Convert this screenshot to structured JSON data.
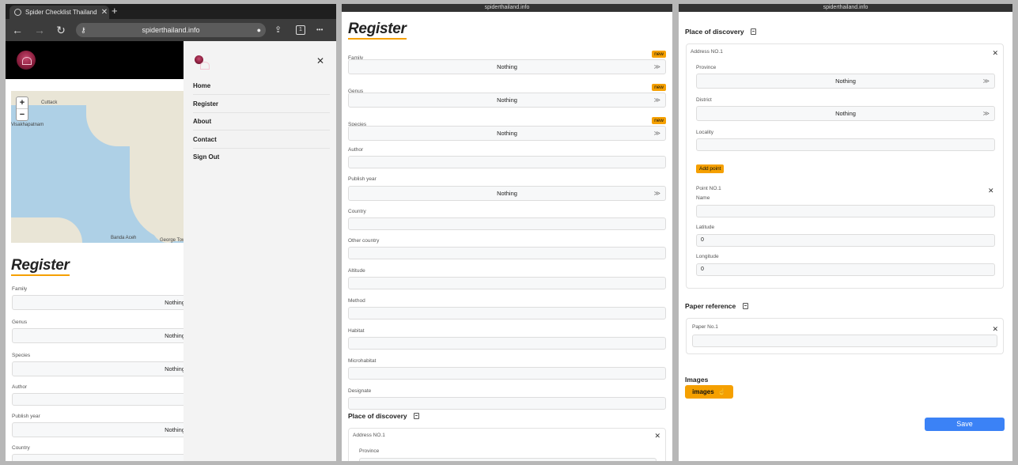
{
  "panel1": {
    "browser": {
      "tab_title": "Spider Checklist Thailand",
      "tab_close": "✕",
      "new_tab": "+",
      "url": "spiderthailand.info",
      "tab_count": "1",
      "back": "←",
      "forward": "→",
      "reload": "↻",
      "share": "⇪",
      "more": "•••"
    },
    "map": {
      "zoom_in": "+",
      "zoom_out": "−",
      "labels": [
        "Cuttack",
        "Visakhapatnam",
        "Banda Aceh",
        "George Town"
      ]
    },
    "menu": {
      "close": "✕",
      "items": [
        "Home",
        "Register",
        "About",
        "Contact",
        "Sign Out"
      ]
    },
    "title": "Register",
    "fields": [
      {
        "label": "Family",
        "value": "Nothing"
      },
      {
        "label": "Genus",
        "value": "Nothing"
      },
      {
        "label": "Species",
        "value": "Nothing"
      },
      {
        "label": "Author",
        "value": ""
      },
      {
        "label": "Publish year",
        "value": "Nothing"
      },
      {
        "label": "Country",
        "value": ""
      }
    ]
  },
  "panel2": {
    "url": "spiderthailand.info",
    "title": "Register",
    "new_badge": "new",
    "chevron": "≫",
    "fields": [
      {
        "label": "Family",
        "value": "Nothing"
      },
      {
        "label": "Genus",
        "value": "Nothing"
      },
      {
        "label": "Species",
        "value": "Nothing"
      },
      {
        "label": "Author",
        "value": ""
      },
      {
        "label": "Publish year",
        "value": "Nothing"
      },
      {
        "label": "Country",
        "value": ""
      },
      {
        "label": "Other country",
        "value": ""
      },
      {
        "label": "Altitude",
        "value": ""
      },
      {
        "label": "Method",
        "value": ""
      },
      {
        "label": "Habitat",
        "value": ""
      },
      {
        "label": "Microhabitat",
        "value": ""
      },
      {
        "label": "Designate",
        "value": ""
      }
    ],
    "place_heading": "Place of discovery",
    "address_label": "Address NO.1",
    "province_label": "Province",
    "close": "✕"
  },
  "panel3": {
    "url": "spiderthailand.info",
    "place_heading": "Place of discovery",
    "address_label": "Address NO.1",
    "province": {
      "label": "Province",
      "value": "Nothing"
    },
    "district": {
      "label": "District",
      "value": "Nothing"
    },
    "locality": {
      "label": "Locality",
      "value": ""
    },
    "add_point": "Add point",
    "point_label": "Point NO.1",
    "point_name": {
      "label": "Name",
      "value": ""
    },
    "latitude": {
      "label": "Latitude",
      "value": "0"
    },
    "longitude": {
      "label": "Longitude",
      "value": "0"
    },
    "paper_heading": "Paper reference",
    "paper_label": "Paper No.1",
    "paper_value": "",
    "images_heading": "Images",
    "images_button": "images",
    "images_icon": "☝",
    "save": "Save",
    "close": "✕",
    "chevron": "≫"
  },
  "colors": {
    "accent": "#f5a000",
    "save": "#3b82f6",
    "header": "#000000"
  }
}
